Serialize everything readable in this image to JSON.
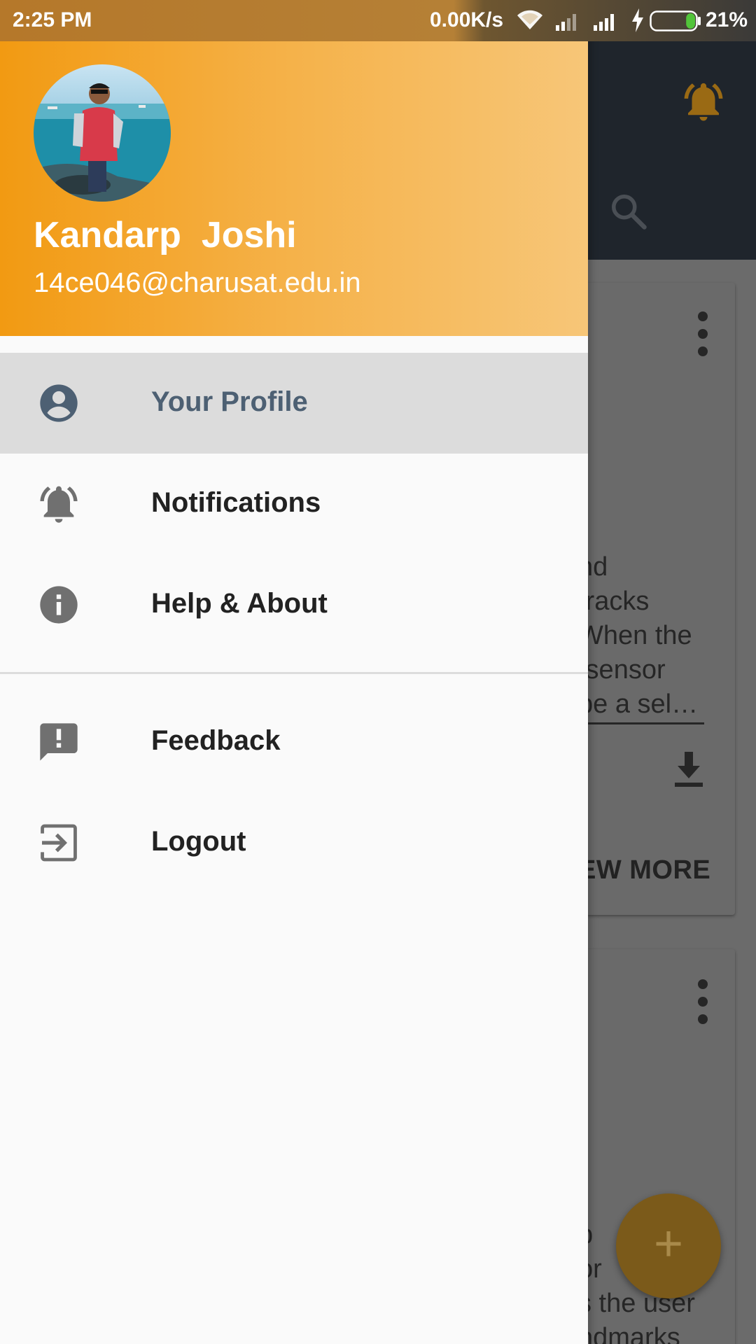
{
  "status_bar": {
    "time": "2:25 PM",
    "network_speed": "0.00K/s",
    "battery_percent": "21%",
    "icons": [
      "wifi-icon",
      "signal-icon",
      "signal-icon",
      "charging-icon",
      "battery-icon"
    ],
    "battery_level": 0.21
  },
  "drawer": {
    "header": {
      "name": "Kandarp  Joshi",
      "email": "14ce046@charusat.edu.in",
      "gradient_colors": [
        "#f29a12",
        "#f7c678"
      ]
    },
    "menu": {
      "profile": {
        "label": "Your Profile",
        "icon": "account-circle-icon",
        "active": true
      },
      "notifications": {
        "label": "Notifications",
        "icon": "bell-ringing-icon"
      },
      "help": {
        "label": "Help & About",
        "icon": "info-icon"
      },
      "feedback": {
        "label": "Feedback",
        "icon": "feedback-icon"
      },
      "logout": {
        "label": "Logout",
        "icon": "exit-icon"
      }
    }
  },
  "background": {
    "appbar_icons": [
      "bell-icon",
      "search-icon"
    ],
    "card1_text": [
      "nd",
      "tracks",
      "When the",
      " sensor",
      "pe a sel…"
    ],
    "view_more": "EW MORE",
    "card2_text": [
      "b",
      "or",
      "s the user",
      "ndmarks"
    ],
    "fab_label": "+",
    "accent": "#f29a12"
  }
}
